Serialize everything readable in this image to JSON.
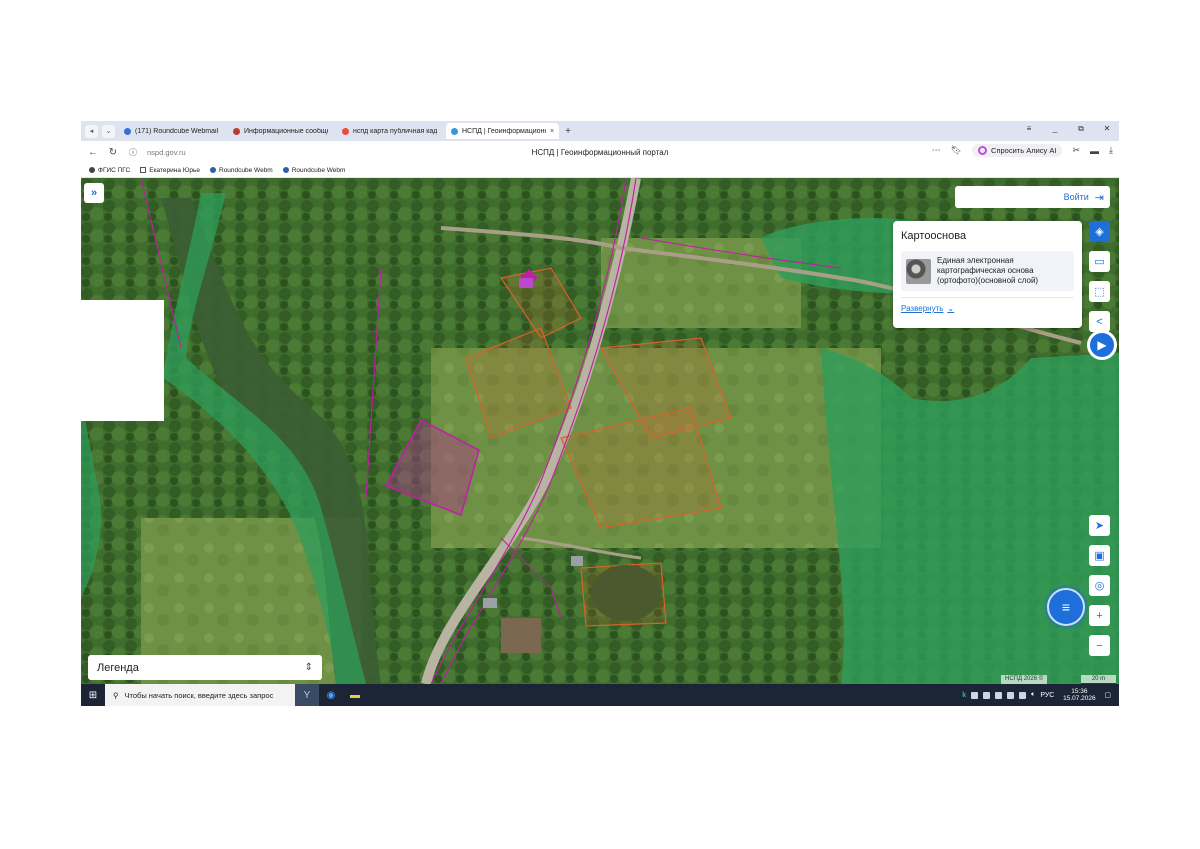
{
  "browser": {
    "tabs": [
      {
        "label": "(171) Roundcube Webmail",
        "favicon_color": "#3a6fd1",
        "active": false
      },
      {
        "label": "Информационные сообщения",
        "favicon_color": "#c0392b",
        "active": false
      },
      {
        "label": "нспд карта публичная кадастровая",
        "favicon_color": "#e74c3c",
        "active": false
      },
      {
        "label": "НСПД | Геоинформационный портал",
        "favicon_color": "#3498db",
        "active": true
      }
    ],
    "new_tab": "+",
    "close_tab": "×",
    "window_controls": [
      "≡",
      "_",
      "⧉",
      "✕"
    ],
    "url": "nspd.gov.ru",
    "page_title": "НСПД | Геоинформационный портал",
    "alice_label": "Спросить Алису AI",
    "bookmarks": [
      "ФГИС ПГС",
      "Екатерина Юрье",
      "Roundcube Webm",
      "Roundcube Webm"
    ]
  },
  "map": {
    "login_label": "Войти",
    "layer_panel": {
      "title": "Картооснова",
      "layer_name": "Единая электронная картографическая основа (ортофото)(основной слой)",
      "expand_label": "Развернуть"
    },
    "legend_label": "Легенда",
    "copyright": "НСПД 2026 ©",
    "scale": "20 m",
    "colors": {
      "accent": "#1e6fd9",
      "forest_zone": "#2e9e5a",
      "parcel_orange": "#d9622b",
      "parcel_magenta": "#c21ca8"
    }
  },
  "taskbar": {
    "search_placeholder": "Чтобы начать поиск, введите здесь запрос",
    "language": "РУС",
    "time": "15:36",
    "date": "15.07.2026"
  }
}
